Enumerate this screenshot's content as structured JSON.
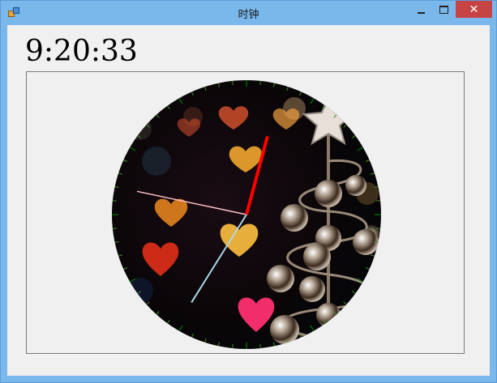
{
  "window": {
    "title": "时钟",
    "close_glyph": "✕"
  },
  "clock": {
    "time_text": "9:20:33",
    "hour": 9,
    "minute": 20,
    "second": 33,
    "colors": {
      "hour_hand": "#ff0000",
      "minute_hand": "#add8e6",
      "second_hand": "#ffc0cb",
      "tick_major": "#006400",
      "tick_minor": "#4a8a2a"
    },
    "face_icon": "bokeh-hearts-christmas-tree-image"
  }
}
